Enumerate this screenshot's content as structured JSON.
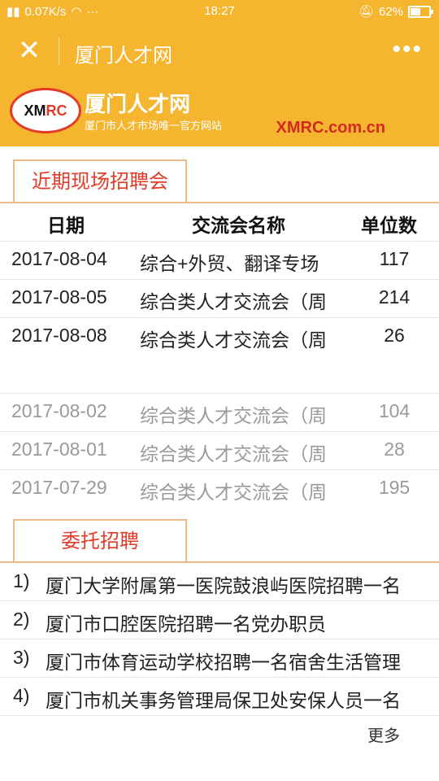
{
  "status_bar": {
    "network_speed": "0.07K/s",
    "dots": "···",
    "time": "18:27",
    "battery_percent": "62%",
    "battery_level": 0.62
  },
  "nav": {
    "title": "厦门人才网",
    "close_icon": "close-icon",
    "more_icon": "more-icon"
  },
  "banner": {
    "logo_text_a": "XM",
    "logo_text_b": "RC",
    "brand": "厦门人才网",
    "slogan": "厦门市人才市场唯一官方网站",
    "domain": "XMRC.com.cn"
  },
  "fairs": {
    "section_title": "近期现场招聘会",
    "headers": [
      "日期",
      "交流会名称",
      "单位数"
    ],
    "rows": [
      {
        "date": "2017-08-04",
        "name": "综合+外贸、翻译专场",
        "count": "117"
      },
      {
        "date": "2017-08-05",
        "name": "综合类人才交流会（周",
        "count": "214"
      },
      {
        "date": "2017-08-08",
        "name": "综合类人才交流会（周",
        "count": "26"
      },
      {
        "date": "2017-08-02",
        "name": "综合类人才交流会（周",
        "count": "104"
      },
      {
        "date": "2017-08-01",
        "name": "综合类人才交流会（周",
        "count": "28"
      },
      {
        "date": "2017-07-29",
        "name": "综合类人才交流会（周",
        "count": "195"
      }
    ]
  },
  "entrusted": {
    "section_title": "委托招聘",
    "items": [
      {
        "num": "1)",
        "text": "厦门大学附属第一医院鼓浪屿医院招聘一名"
      },
      {
        "num": "2)",
        "text": "厦门市口腔医院招聘一名党办职员"
      },
      {
        "num": "3)",
        "text": "厦门市体育运动学校招聘一名宿舍生活管理"
      },
      {
        "num": "4)",
        "text": "厦门市机关事务管理局保卫处安保人员一名"
      }
    ],
    "more_label": "更多"
  },
  "colors": {
    "brand_yellow": "#f5b52e",
    "accent_red": "#e23b2a",
    "tab_border": "#f0b98a"
  }
}
